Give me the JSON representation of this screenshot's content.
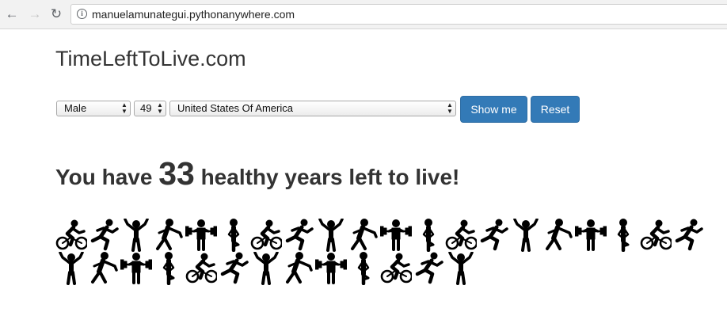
{
  "browser": {
    "url": "manuelamunategui.pythonanywhere.com",
    "back_glyph": "←",
    "forward_glyph": "→",
    "reload_glyph": "↻",
    "info_glyph": "i"
  },
  "site": {
    "title": "TimeLeftToLive.com"
  },
  "form": {
    "sex": "Male",
    "age": "49",
    "country": "United States Of America",
    "show_label": "Show me",
    "reset_label": "Reset"
  },
  "result": {
    "prefix": "You have",
    "years": "33",
    "suffix": "healthy years left to live!"
  },
  "activity_icons": {
    "row1": [
      "cyclist",
      "runner",
      "cheer",
      "stretch",
      "weightlifter",
      "yoga",
      "cyclist",
      "runner",
      "cheer",
      "stretch",
      "weightlifter",
      "yoga",
      "cyclist",
      "runner",
      "cheer",
      "stretch",
      "weightlifter",
      "yoga",
      "cyclist",
      "runner"
    ],
    "row2": [
      "cheer",
      "stretch",
      "weightlifter",
      "yoga",
      "cyclist",
      "runner",
      "cheer",
      "stretch",
      "weightlifter",
      "yoga",
      "cyclist",
      "runner",
      "cheer"
    ]
  },
  "colors": {
    "accent": "#337ab7",
    "text": "#333333",
    "icon": "#000000"
  }
}
